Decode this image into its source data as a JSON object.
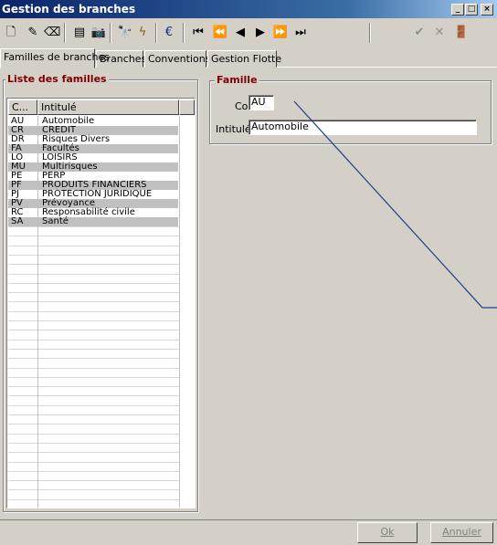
{
  "window": {
    "title": "Gestion des branches",
    "controls": [
      "_",
      "□",
      "×"
    ]
  },
  "toolbar": {
    "icons": [
      {
        "name": "new-icon",
        "glyph": "🗋"
      },
      {
        "name": "edit-icon",
        "glyph": "✎"
      },
      {
        "name": "erase-icon",
        "glyph": "⌫"
      },
      {
        "name": "list-icon",
        "glyph": "▤"
      },
      {
        "name": "camera-icon",
        "glyph": "📷"
      },
      {
        "name": "binoculars-icon",
        "glyph": "🔭"
      },
      {
        "name": "lightning-icon",
        "glyph": "ϟ"
      },
      {
        "name": "euro-icon",
        "glyph": "€"
      },
      {
        "name": "first-record-icon",
        "glyph": "⏮"
      },
      {
        "name": "fast-back-icon",
        "glyph": "⏪"
      },
      {
        "name": "prev-record-icon",
        "glyph": "◀"
      },
      {
        "name": "next-record-icon",
        "glyph": "▶"
      },
      {
        "name": "fast-forward-icon",
        "glyph": "⏩"
      },
      {
        "name": "last-record-icon",
        "glyph": "⏭"
      },
      {
        "name": "validate-icon",
        "glyph": "✔"
      },
      {
        "name": "cancel-icon",
        "glyph": "✕"
      },
      {
        "name": "exit-icon",
        "glyph": "🚪"
      }
    ]
  },
  "tabs": [
    {
      "label": "Familles de branches"
    },
    {
      "label": "Branches"
    },
    {
      "label": "Conventions"
    },
    {
      "label": "Gestion Flotte"
    }
  ],
  "list": {
    "title": "Liste des familles",
    "columns": [
      "C...",
      "Intitulé"
    ],
    "rows": [
      {
        "code": "AU",
        "label": "Automobile"
      },
      {
        "code": "CR",
        "label": "CREDIT"
      },
      {
        "code": "DR",
        "label": "Risques Divers"
      },
      {
        "code": "FA",
        "label": "Facultés"
      },
      {
        "code": "LO",
        "label": "LOISIRS"
      },
      {
        "code": "MU",
        "label": "Multirisques"
      },
      {
        "code": "PE",
        "label": "PERP"
      },
      {
        "code": "PF",
        "label": "PRODUITS FINANCIERS"
      },
      {
        "code": "PJ",
        "label": "PROTECTION JURIDIQUE"
      },
      {
        "code": "PV",
        "label": "Prévoyance"
      },
      {
        "code": "RC",
        "label": "Responsabilité civile"
      },
      {
        "code": "SA",
        "label": "Santé"
      }
    ]
  },
  "famille": {
    "title": "Famille",
    "code_label": "Code",
    "code_value": "AU",
    "intitule_label": "Intitulé",
    "intitule_value": "Automobile"
  },
  "buttons": {
    "ok": "Ok",
    "cancel": "Annuler"
  }
}
